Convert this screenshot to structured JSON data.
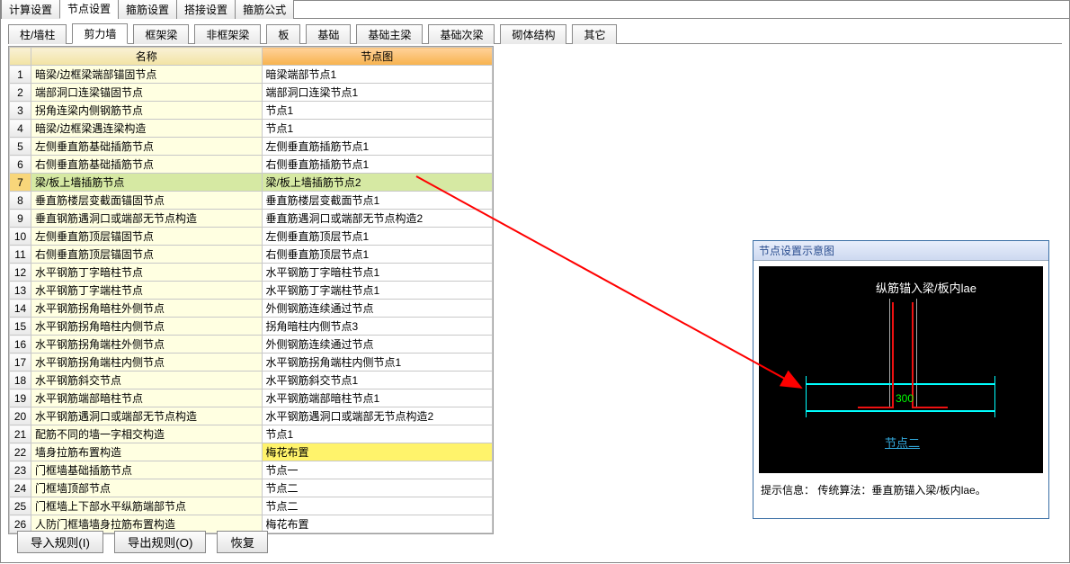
{
  "topTabs": {
    "t0": "计算设置",
    "t1": "节点设置",
    "t2": "箍筋设置",
    "t3": "搭接设置",
    "t4": "箍筋公式"
  },
  "subTabs": {
    "s0": "柱/墙柱",
    "s1": "剪力墙",
    "s2": "框架梁",
    "s3": "非框架梁",
    "s4": "板",
    "s5": "基础",
    "s6": "基础主梁",
    "s7": "基础次梁",
    "s8": "砌体结构",
    "s9": "其它"
  },
  "headers": {
    "name": "名称",
    "map": "节点图"
  },
  "rows": [
    {
      "i": "1",
      "n": "暗梁/边框梁端部锚固节点",
      "m": "暗梁端部节点1"
    },
    {
      "i": "2",
      "n": "端部洞口连梁锚固节点",
      "m": "端部洞口连梁节点1"
    },
    {
      "i": "3",
      "n": "拐角连梁内侧钢筋节点",
      "m": "节点1"
    },
    {
      "i": "4",
      "n": "暗梁/边框梁遇连梁构造",
      "m": "节点1"
    },
    {
      "i": "5",
      "n": "左侧垂直筋基础插筋节点",
      "m": "左侧垂直筋插筋节点1"
    },
    {
      "i": "6",
      "n": "右侧垂直筋基础插筋节点",
      "m": "右侧垂直筋插筋节点1"
    },
    {
      "i": "7",
      "n": "梁/板上墙插筋节点",
      "m": "梁/板上墙插筋节点2",
      "sel": true
    },
    {
      "i": "8",
      "n": "垂直筋楼层变截面锚固节点",
      "m": "垂直筋楼层变截面节点1"
    },
    {
      "i": "9",
      "n": "垂直钢筋遇洞口或端部无节点构造",
      "m": "垂直筋遇洞口或端部无节点构造2"
    },
    {
      "i": "10",
      "n": "左侧垂直筋顶层锚固节点",
      "m": "左侧垂直筋顶层节点1"
    },
    {
      "i": "11",
      "n": "右侧垂直筋顶层锚固节点",
      "m": "右侧垂直筋顶层节点1"
    },
    {
      "i": "12",
      "n": "水平钢筋丁字暗柱节点",
      "m": "水平钢筋丁字暗柱节点1"
    },
    {
      "i": "13",
      "n": "水平钢筋丁字端柱节点",
      "m": "水平钢筋丁字端柱节点1"
    },
    {
      "i": "14",
      "n": "水平钢筋拐角暗柱外侧节点",
      "m": "外侧钢筋连续通过节点"
    },
    {
      "i": "15",
      "n": "水平钢筋拐角暗柱内侧节点",
      "m": "拐角暗柱内侧节点3"
    },
    {
      "i": "16",
      "n": "水平钢筋拐角端柱外侧节点",
      "m": "外侧钢筋连续通过节点"
    },
    {
      "i": "17",
      "n": "水平钢筋拐角端柱内侧节点",
      "m": "水平钢筋拐角端柱内侧节点1"
    },
    {
      "i": "18",
      "n": "水平钢筋斜交节点",
      "m": "水平钢筋斜交节点1"
    },
    {
      "i": "19",
      "n": "水平钢筋端部暗柱节点",
      "m": "水平钢筋端部暗柱节点1"
    },
    {
      "i": "20",
      "n": "水平钢筋遇洞口或端部无节点构造",
      "m": "水平钢筋遇洞口或端部无节点构造2"
    },
    {
      "i": "21",
      "n": "配筋不同的墙一字相交构造",
      "m": "节点1"
    },
    {
      "i": "22",
      "n": "墙身拉筋布置构造",
      "m": "梅花布置",
      "hilite": true
    },
    {
      "i": "23",
      "n": "门框墙基础插筋节点",
      "m": "节点一"
    },
    {
      "i": "24",
      "n": "门框墙顶部节点",
      "m": "节点二"
    },
    {
      "i": "25",
      "n": "门框墙上下部水平纵筋端部节点",
      "m": "节点二"
    },
    {
      "i": "26",
      "n": "人防门框墙墙身拉筋布置构造",
      "m": "梅花布置"
    }
  ],
  "buttons": {
    "import": "导入规则(I)",
    "export": "导出规则(O)",
    "restore": "恢复"
  },
  "preview": {
    "caption": "节点设置示意图",
    "label1": "纵筋锚入梁/板内lae",
    "dim": "300",
    "link": "节点二",
    "hint_prefix": "提示信息：",
    "hint_body": "传统算法：垂直筋锚入梁/板内lae。"
  }
}
